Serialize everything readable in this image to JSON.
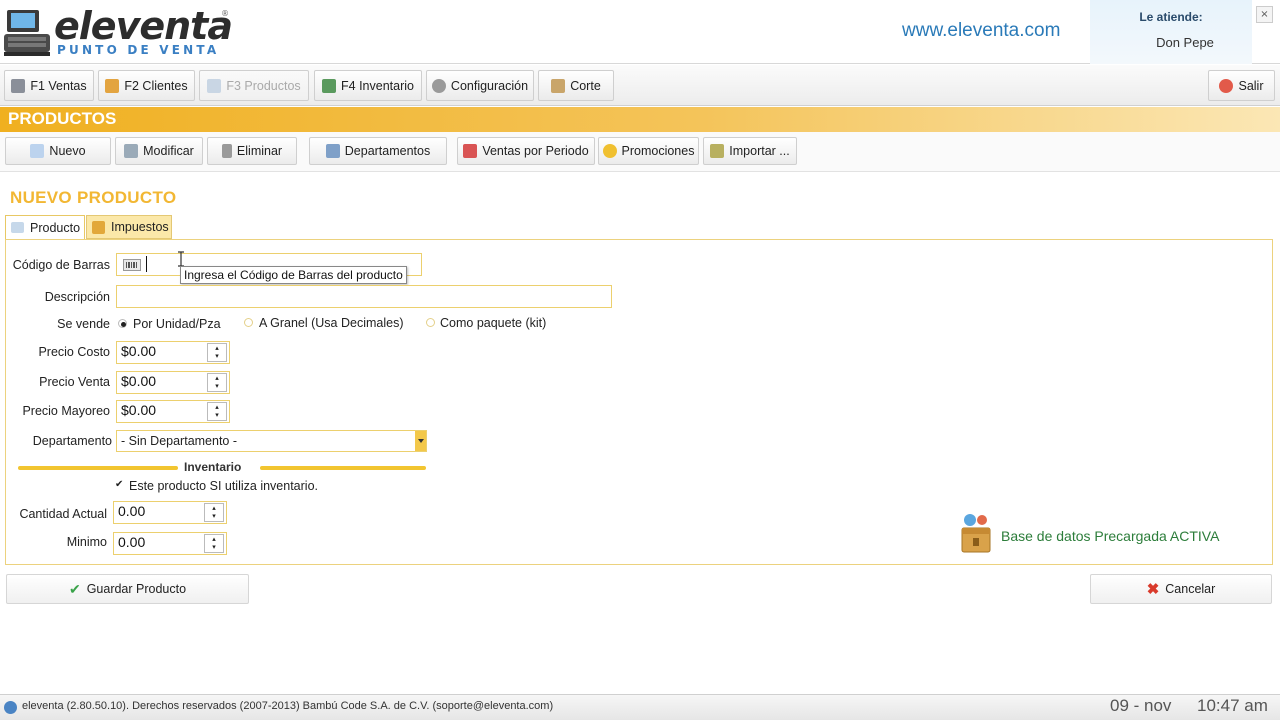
{
  "header": {
    "logo_name": "eleventa",
    "logo_reg": "®",
    "logo_subtitle": "PUNTO DE VENTA",
    "website": "www.eleventa.com",
    "attend_label": "Le atiende:",
    "attend_name": "Don Pepe",
    "close_label": "×"
  },
  "main_toolbar": {
    "ventas": "F1 Ventas",
    "clientes": "F2 Clientes",
    "productos": "F3 Productos",
    "inventario": "F4 Inventario",
    "configuracion": "Configuración",
    "corte": "Corte",
    "salir": "Salir"
  },
  "section": {
    "title": "PRODUCTOS"
  },
  "sub_toolbar": {
    "nuevo": "Nuevo",
    "modificar": "Modificar",
    "eliminar": "Eliminar",
    "departamentos": "Departamentos",
    "ventas_periodo": "Ventas por Periodo",
    "promociones": "Promociones",
    "importar": "Importar ..."
  },
  "form": {
    "title": "NUEVO PRODUCTO",
    "tabs": {
      "producto": "Producto",
      "impuestos": "Impuestos"
    },
    "labels": {
      "codigo": "Código de Barras",
      "descripcion": "Descripción",
      "se_vende": "Se vende",
      "precio_costo": "Precio Costo",
      "precio_venta": "Precio Venta",
      "precio_mayoreo": "Precio Mayoreo",
      "departamento": "Departamento",
      "cantidad_actual": "Cantidad Actual",
      "minimo": "Minimo"
    },
    "codigo_value": "",
    "descripcion_value": "",
    "tooltip": "Ingresa el Código de Barras del producto",
    "sell_options": [
      "Por Unidad/Pza",
      "A Granel (Usa Decimales)",
      "Como paquete (kit)"
    ],
    "selected_sell_option": "Por Unidad/Pza",
    "precio_costo": "$0.00",
    "precio_venta": "$0.00",
    "precio_mayoreo": "$0.00",
    "departamento_value": "- Sin Departamento -",
    "inventario_title": "Inventario",
    "uses_inventory_label": "Este producto SI utiliza inventario.",
    "uses_inventory_checked": true,
    "cantidad_actual": "0.00",
    "minimo": "0.00",
    "db_status": "Base de datos Precargada ACTIVA",
    "save_label": "Guardar Producto",
    "cancel_label": "Cancelar"
  },
  "status_bar": {
    "info": "eleventa (2.80.50.10). Derechos reservados (2007-2013) Bambú Code S.A. de C.V. (soporte@eleventa.com)",
    "date": "09 - nov",
    "time": "10:47 am"
  },
  "colors": {
    "accent": "#f2b733",
    "link_blue": "#2a7ab8",
    "status_green": "#2c7d3a",
    "cancel_red": "#d93a2b"
  }
}
